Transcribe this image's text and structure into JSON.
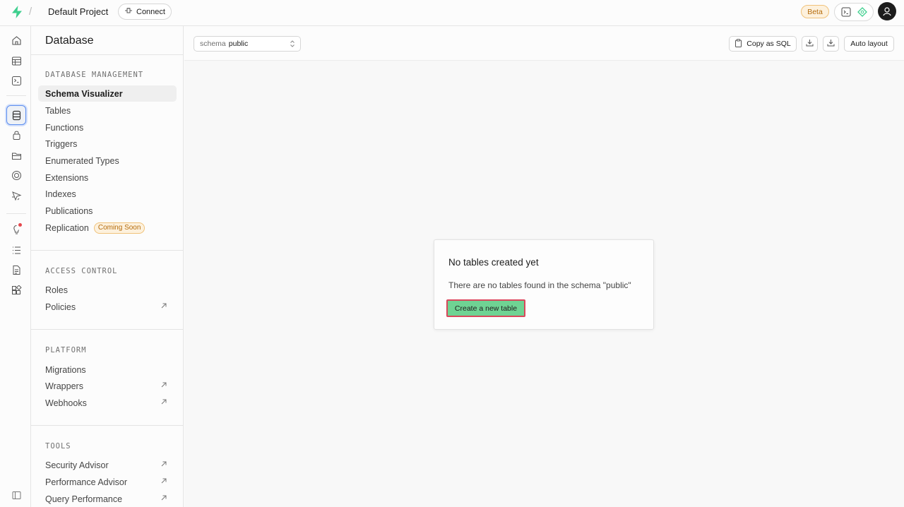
{
  "topbar": {
    "project_name": "Default Project",
    "separator": "/",
    "connect_label": "Connect",
    "beta_label": "Beta"
  },
  "rail": {
    "items": [
      "home-icon",
      "table-editor-icon",
      "sql-editor-icon",
      "database-icon",
      "auth-icon",
      "storage-icon",
      "edge-functions-icon",
      "realtime-icon",
      "advisors-icon",
      "logs-icon",
      "reports-icon",
      "integrations-icon",
      "collapse-sidebar-icon"
    ],
    "active": "database-icon"
  },
  "sidebar": {
    "title": "Database",
    "sections": [
      {
        "title": "DATABASE MANAGEMENT",
        "items": [
          {
            "label": "Schema Visualizer",
            "active": true
          },
          {
            "label": "Tables"
          },
          {
            "label": "Functions"
          },
          {
            "label": "Triggers"
          },
          {
            "label": "Enumerated Types"
          },
          {
            "label": "Extensions"
          },
          {
            "label": "Indexes"
          },
          {
            "label": "Publications"
          },
          {
            "label": "Replication",
            "badge": "Coming Soon"
          }
        ]
      },
      {
        "title": "ACCESS CONTROL",
        "items": [
          {
            "label": "Roles"
          },
          {
            "label": "Policies",
            "external": true
          }
        ]
      },
      {
        "title": "PLATFORM",
        "items": [
          {
            "label": "Migrations"
          },
          {
            "label": "Wrappers",
            "external": true
          },
          {
            "label": "Webhooks",
            "external": true
          }
        ]
      },
      {
        "title": "TOOLS",
        "items": [
          {
            "label": "Security Advisor",
            "external": true
          },
          {
            "label": "Performance Advisor",
            "external": true
          },
          {
            "label": "Query Performance",
            "external": true
          }
        ]
      }
    ]
  },
  "toolbar": {
    "schema_label": "schema",
    "schema_value": "public",
    "copy_sql_label": "Copy as SQL",
    "auto_layout_label": "Auto layout"
  },
  "empty_state": {
    "title": "No tables created yet",
    "description": "There are no tables found in the schema \"public\"",
    "create_button": "Create a new table"
  },
  "colors": {
    "brand": "#3ecf8e",
    "create_button_bg": "#6fd393",
    "highlight_border": "#d9475b",
    "active_rail_border": "#5b8def",
    "beta_bg": "#fdf1dd",
    "beta_text": "#b56c0c"
  }
}
